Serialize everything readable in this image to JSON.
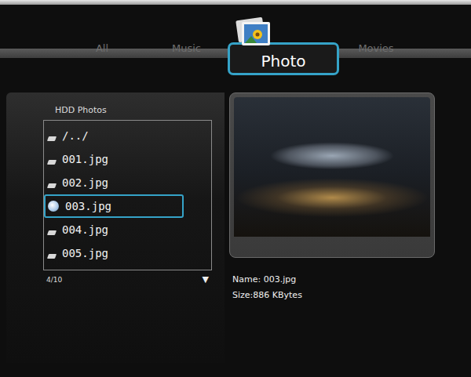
{
  "tabs": [
    {
      "label": "All",
      "selected": false
    },
    {
      "label": "Music",
      "selected": false
    },
    {
      "label": "Photo",
      "selected": true
    },
    {
      "label": "Movies",
      "selected": false
    }
  ],
  "browser": {
    "title": "HDD Photos",
    "items": [
      {
        "name": "/../",
        "selected": false
      },
      {
        "name": "001.jpg",
        "selected": false
      },
      {
        "name": "002.jpg",
        "selected": false
      },
      {
        "name": "003.jpg",
        "selected": true
      },
      {
        "name": "004.jpg",
        "selected": false
      },
      {
        "name": "005.jpg",
        "selected": false
      }
    ],
    "position": "4/10",
    "scroll_icon": "▼"
  },
  "preview": {
    "name": "Name: 003.jpg",
    "size": "Size:886 KBytes"
  }
}
